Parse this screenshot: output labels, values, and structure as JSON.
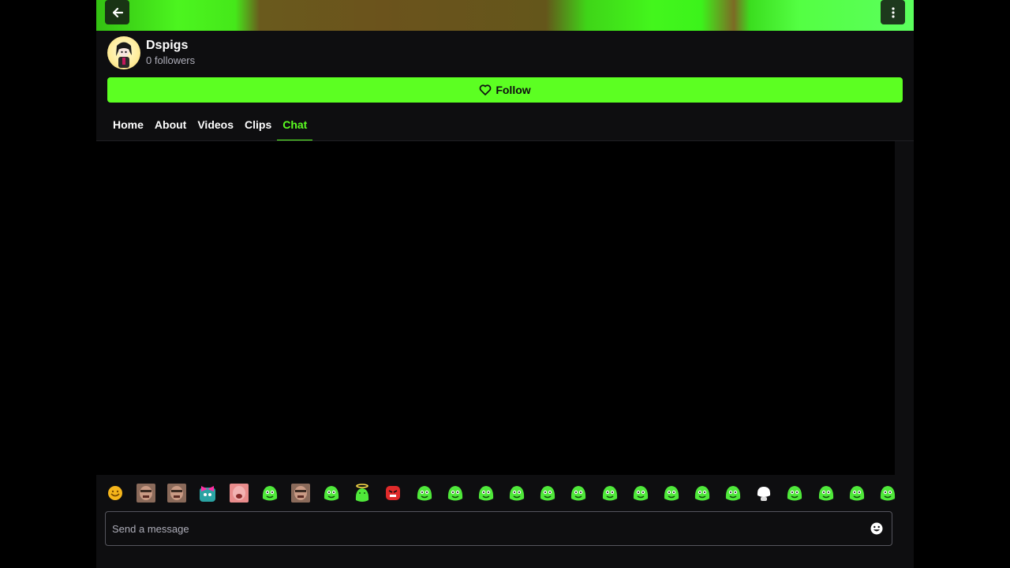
{
  "channel": {
    "name": "Dspigs",
    "followers": "0 followers"
  },
  "follow_button": {
    "label": "Follow"
  },
  "tabs": [
    {
      "label": "Home",
      "active": false
    },
    {
      "label": "About",
      "active": false
    },
    {
      "label": "Videos",
      "active": false
    },
    {
      "label": "Clips",
      "active": false
    },
    {
      "label": "Chat",
      "active": true
    }
  ],
  "chat_input": {
    "placeholder": "Send a message",
    "value": ""
  },
  "icons": {
    "back": "arrow-left-icon",
    "more": "more-vertical-icon",
    "follow": "heart-icon",
    "emote_picker": "smiley-icon"
  },
  "colors": {
    "accent": "#5cff22",
    "background": "#0e0e10",
    "chat_background": "#000000"
  },
  "emotes": [
    "emoji-smile-emote",
    "face-photo-emote",
    "face-photo-emote",
    "pink-bow-emote",
    "crying-face-emote",
    "green-blob-emote",
    "face-photo-emote",
    "green-blob-emote",
    "halo-blob-emote",
    "angry-red-emote",
    "green-blob-emote",
    "green-blob-emote",
    "green-blob-emote",
    "green-blob-emote",
    "green-blob-emote",
    "green-blob-emote",
    "green-blob-emote",
    "green-blob-emote",
    "green-blob-emote",
    "green-blob-emote",
    "green-blob-emote",
    "white-blob-emote",
    "green-blob-emote",
    "green-blob-emote",
    "green-blob-emote",
    "green-blob-emote"
  ]
}
